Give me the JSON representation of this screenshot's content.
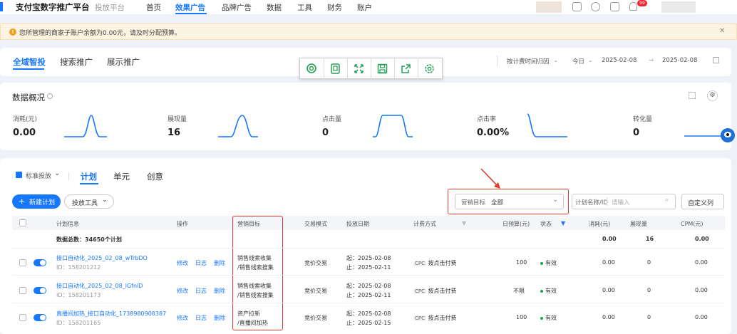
{
  "header": {
    "logo": "支付宝数字推广平台",
    "platform": "投放平台",
    "nav": [
      "首页",
      "效果广告",
      "品牌广告",
      "数据",
      "工具",
      "财务",
      "账户"
    ],
    "active_nav": "效果广告",
    "notification_count": "99"
  },
  "warning": {
    "text": "您所管理的商家子账户余额为0.00元，请及时分配预算。"
  },
  "top_tabs": [
    "全域智投",
    "搜索推广",
    "展示推广"
  ],
  "date_controls": {
    "time_mode": "按计费时间归因",
    "range_preset": "今日",
    "start_date": "2025-02-08",
    "end_date": "2025-02-08"
  },
  "toolbar_icons": [
    "search-circle-icon",
    "tablet-icon",
    "expand-icon",
    "save-icon",
    "share-icon",
    "settings-icon"
  ],
  "overview": {
    "title": "数据概况",
    "metrics": [
      {
        "label": "消耗(元)",
        "value": "0.00"
      },
      {
        "label": "展现量",
        "value": "16"
      },
      {
        "label": "点击量",
        "value": "0"
      },
      {
        "label": "点击率",
        "value": "0.00%"
      },
      {
        "label": "转化量",
        "value": "0"
      }
    ]
  },
  "plans": {
    "mode": "标准投放",
    "tabs": [
      "计划",
      "单元",
      "创意"
    ],
    "new_button": "新建计划",
    "tools_button": "投放工具",
    "filter_label": "营销目标",
    "filter_value": "全部",
    "search_label": "计划名称/ID",
    "search_placeholder": "请输入",
    "custom_columns": "自定义列",
    "columns": [
      "计划信息",
      "操作",
      "营销目标",
      "交易模式",
      "投放日期",
      "计费方式",
      "日预算(元)",
      "状态",
      "消耗(元)",
      "展现量",
      "CPM(元)"
    ],
    "summary": {
      "label": "数据总数：34650个计划",
      "spend": "0.00",
      "impressions": "16",
      "cpm": "0.00"
    },
    "actions": [
      "修改",
      "日志",
      "删除"
    ],
    "rows": [
      {
        "name": "接口自动化_2025_02_08_wTrbDO",
        "id": "ID：158201212",
        "goal1": "销售线索收集",
        "goal2": "/销售线索搜集",
        "trade": "竞价交易",
        "start": "起：2025-02-08",
        "end": "止：2025-02-11",
        "billing_tag": "CPC",
        "billing": "按点击付费",
        "budget": "100",
        "status": "有效",
        "spend": "0.00",
        "impressions": "0",
        "cpm": "0.00"
      },
      {
        "name": "接口自动化_2025_02_08_lGfnlD",
        "id": "ID：158201173",
        "goal1": "销售线索收集",
        "goal2": "/销售线索搜集",
        "trade": "竞价交易",
        "start": "起：2025-02-08",
        "end": "止：2025-02-11",
        "billing_tag": "CPC",
        "billing": "按点击付费",
        "budget": "不限",
        "status": "有效",
        "spend": "0.00",
        "impressions": "0",
        "cpm": "0.00"
      },
      {
        "name": "直播间加热_接口自动化_1738980908387",
        "id": "ID：158201165",
        "goal1": "资产拉新",
        "goal2": "/直播间加热",
        "trade": "竞价交易",
        "start": "起：2025-02-08",
        "end": "止：2025-02-15",
        "billing_tag": "CPC",
        "billing": "按点击付费",
        "budget": "100",
        "status": "有效",
        "spend": "0.00",
        "impressions": "0",
        "cpm": "0.00"
      }
    ]
  }
}
